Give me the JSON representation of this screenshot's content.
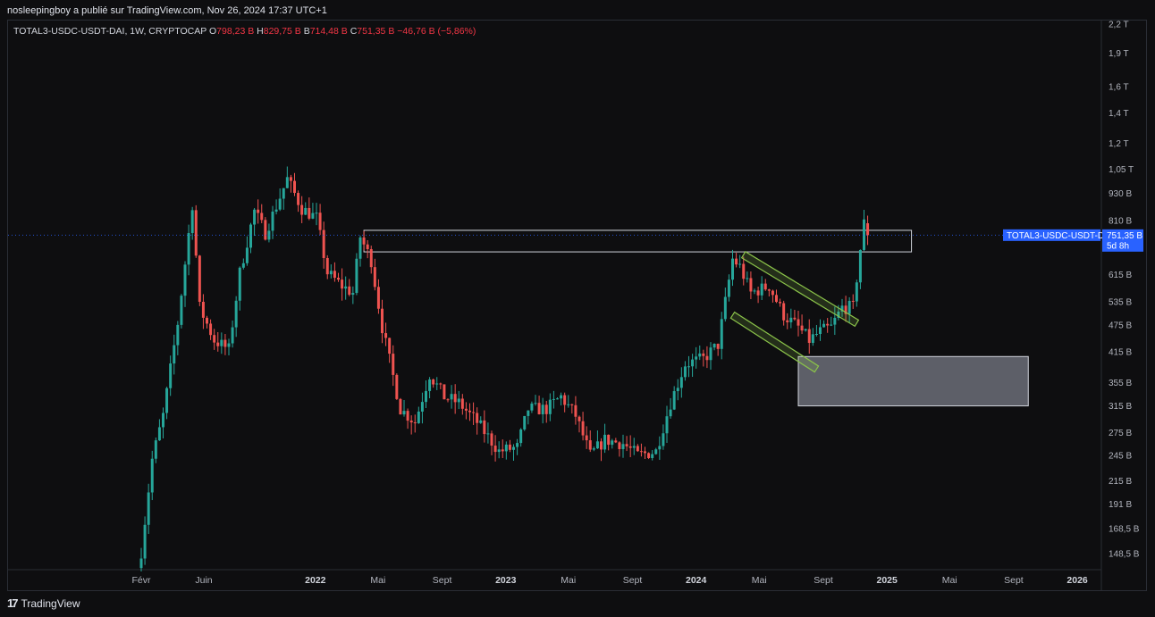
{
  "header": {
    "published_text": "nosleepingboy a publié sur TradingView.com, Nov 26, 2024 17:37 UTC+1"
  },
  "legend": {
    "symbol": "TOTAL3-USDC-USDT-DAI, 1W, CRYPTOCAP",
    "o_label": "O",
    "o_value": "798,23 B",
    "h_label": "H",
    "h_value": "829,75 B",
    "b_label": "B",
    "b_value": "714,48 B",
    "c_label": "C",
    "c_value": "751,35 B",
    "change": "−46,76 B (−5,86%)"
  },
  "price_tag": {
    "symbol": "TOTAL3-USDC-USDT-DAI",
    "price": "751,35 B",
    "countdown": "5d 8h"
  },
  "footer": {
    "brand": "TradingView",
    "icon": "tradingview-logo-icon"
  },
  "colors": {
    "up": "#26a69a",
    "down": "#ef5350",
    "background": "#0e0e10",
    "box_outline": "#d1d4dc",
    "demand_zone": "#787b86",
    "channel": "#8bc34a",
    "price_tag_bg": "#2962ff"
  },
  "chart_data": {
    "type": "candlestick",
    "title": "TOTAL3-USDC-USDT-DAI, 1W, CRYPTOCAP",
    "y_scale": "log",
    "ylim": [
      140,
      2300
    ],
    "y_unit": "B",
    "y_ticks": [
      {
        "value": 2200,
        "label": "2,2 T"
      },
      {
        "value": 1900,
        "label": "1,9 T"
      },
      {
        "value": 1600,
        "label": "1,6 T"
      },
      {
        "value": 1400,
        "label": "1,4 T"
      },
      {
        "value": 1200,
        "label": "1,2 T"
      },
      {
        "value": 1050,
        "label": "1,05 T"
      },
      {
        "value": 930,
        "label": "930 B"
      },
      {
        "value": 810,
        "label": "810 B"
      },
      {
        "value": 615,
        "label": "615 B"
      },
      {
        "value": 535,
        "label": "535 B"
      },
      {
        "value": 475,
        "label": "475 B"
      },
      {
        "value": 415,
        "label": "415 B"
      },
      {
        "value": 355,
        "label": "355 B"
      },
      {
        "value": 315,
        "label": "315 B"
      },
      {
        "value": 275,
        "label": "275 B"
      },
      {
        "value": 245,
        "label": "245 B"
      },
      {
        "value": 215,
        "label": "215 B"
      },
      {
        "value": 191,
        "label": "191 B"
      },
      {
        "value": 168.5,
        "label": "168,5 B"
      },
      {
        "value": 148.5,
        "label": "148,5 B"
      }
    ],
    "x_ticks": [
      {
        "date": "2021-02",
        "label": "Févr",
        "year": false
      },
      {
        "date": "2021-06",
        "label": "Juin",
        "year": false
      },
      {
        "date": "2022-01",
        "label": "2022",
        "year": true
      },
      {
        "date": "2022-05",
        "label": "Mai",
        "year": false
      },
      {
        "date": "2022-09",
        "label": "Sept",
        "year": false
      },
      {
        "date": "2023-01",
        "label": "2023",
        "year": true
      },
      {
        "date": "2023-05",
        "label": "Mai",
        "year": false
      },
      {
        "date": "2023-09",
        "label": "Sept",
        "year": false
      },
      {
        "date": "2024-01",
        "label": "2024",
        "year": true
      },
      {
        "date": "2024-05",
        "label": "Mai",
        "year": false
      },
      {
        "date": "2024-09",
        "label": "Sept",
        "year": false
      },
      {
        "date": "2025-01",
        "label": "2025",
        "year": true
      },
      {
        "date": "2025-05",
        "label": "Mai",
        "year": false
      },
      {
        "date": "2025-09",
        "label": "Sept",
        "year": false
      },
      {
        "date": "2026-01",
        "label": "2026",
        "year": true
      }
    ],
    "series": [
      {
        "interval": "1W",
        "path": [
          [
            "2021-02-01",
            150
          ],
          [
            "2021-02-22",
            240
          ],
          [
            "2021-03-15",
            300
          ],
          [
            "2021-04-12",
            480
          ],
          [
            "2021-05-10",
            880
          ],
          [
            "2021-05-24",
            520
          ],
          [
            "2021-06-21",
            440
          ],
          [
            "2021-07-19",
            420
          ],
          [
            "2021-08-09",
            620
          ],
          [
            "2021-09-06",
            850
          ],
          [
            "2021-09-27",
            760
          ],
          [
            "2021-11-08",
            1000
          ],
          [
            "2021-12-06",
            860
          ],
          [
            "2022-01-03",
            820
          ],
          [
            "2022-01-24",
            620
          ],
          [
            "2022-02-21",
            580
          ],
          [
            "2022-03-14",
            560
          ],
          [
            "2022-03-28",
            745
          ],
          [
            "2022-04-18",
            660
          ],
          [
            "2022-05-09",
            470
          ],
          [
            "2022-06-13",
            310
          ],
          [
            "2022-07-11",
            290
          ],
          [
            "2022-08-08",
            370
          ],
          [
            "2022-09-05",
            330
          ],
          [
            "2022-10-03",
            320
          ],
          [
            "2022-11-07",
            290
          ],
          [
            "2022-12-19",
            250
          ],
          [
            "2023-01-23",
            255
          ],
          [
            "2023-02-13",
            310
          ],
          [
            "2023-03-20",
            310
          ],
          [
            "2023-04-17",
            330
          ],
          [
            "2023-05-15",
            300
          ],
          [
            "2023-06-12",
            245
          ],
          [
            "2023-07-10",
            265
          ],
          [
            "2023-08-14",
            260
          ],
          [
            "2023-09-11",
            245
          ],
          [
            "2023-10-16",
            250
          ],
          [
            "2023-11-13",
            320
          ],
          [
            "2023-12-11",
            390
          ],
          [
            "2024-01-15",
            400
          ],
          [
            "2024-02-12",
            430
          ],
          [
            "2024-03-11",
            665
          ],
          [
            "2024-03-25",
            640
          ],
          [
            "2024-04-15",
            560
          ],
          [
            "2024-05-20",
            580
          ],
          [
            "2024-06-17",
            500
          ],
          [
            "2024-07-15",
            470
          ],
          [
            "2024-08-05",
            440
          ],
          [
            "2024-08-26",
            460
          ],
          [
            "2024-09-16",
            470
          ],
          [
            "2024-10-07",
            520
          ],
          [
            "2024-10-28",
            520
          ],
          [
            "2024-11-11",
            700
          ],
          [
            "2024-11-18",
            798
          ],
          [
            "2024-11-25",
            751
          ]
        ]
      }
    ],
    "last_candle": {
      "date": "2024-11-25",
      "open": 798.23,
      "high": 829.75,
      "low": 714.48,
      "close": 751.35,
      "change": -46.76,
      "change_pct": -5.86
    },
    "annotations": [
      {
        "type": "resistance_box",
        "from": "2022-04-04",
        "to": "2025-02-17",
        "low": 690,
        "high": 770
      },
      {
        "type": "demand_zone",
        "from": "2024-07-15",
        "to": "2025-09-29",
        "low": 315,
        "high": 405
      },
      {
        "type": "falling_channel",
        "upper": [
          [
            "2024-04-01",
            680
          ],
          [
            "2024-11-04",
            480
          ]
        ],
        "lower": [
          [
            "2024-03-11",
            500
          ],
          [
            "2024-08-19",
            380
          ]
        ]
      }
    ],
    "grid": false,
    "legend_position": "top-left"
  }
}
